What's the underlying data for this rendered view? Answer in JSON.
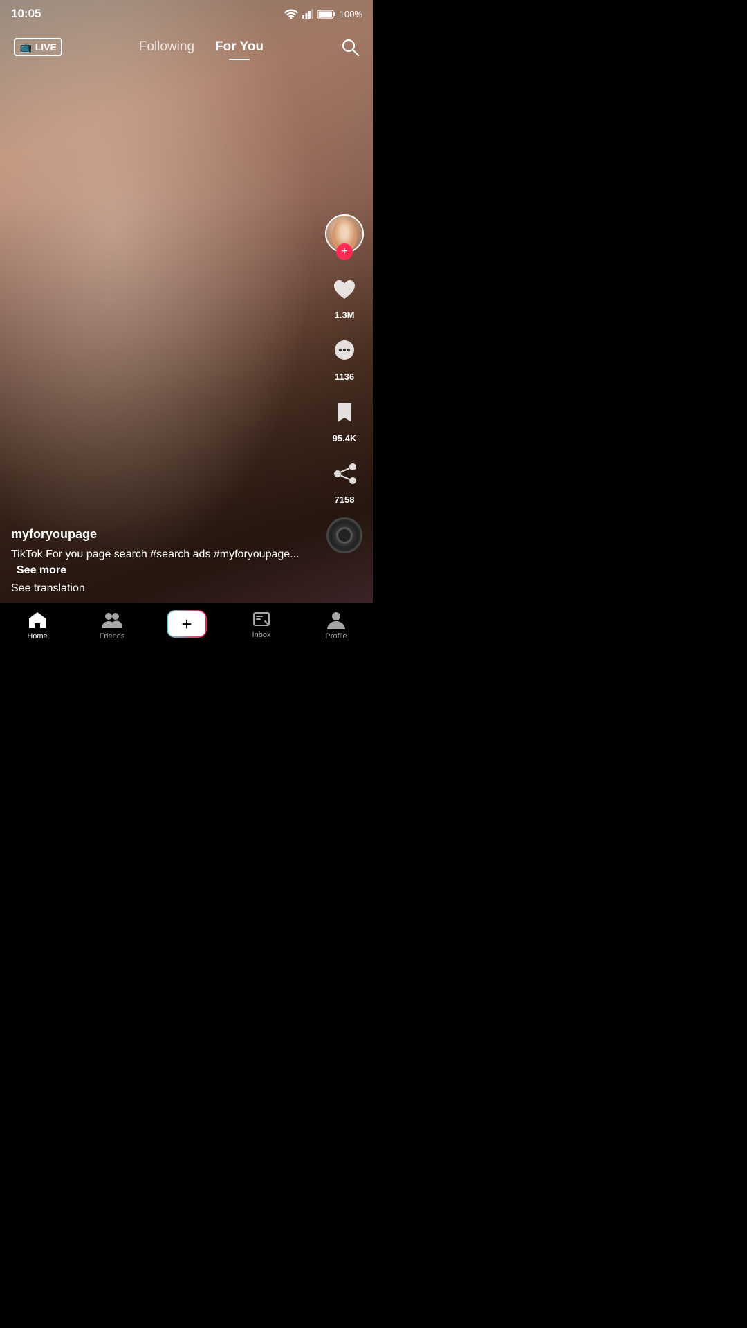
{
  "status": {
    "time": "10:05",
    "battery": "100%",
    "wifi": true,
    "signal": true
  },
  "nav": {
    "live_label": "LIVE",
    "following_label": "Following",
    "foryou_label": "For You",
    "active_tab": "foryou"
  },
  "video": {
    "username": "myforyoupage",
    "caption": "TikTok For you page search #search ads #myforyoupage...",
    "see_more": "See more",
    "see_translation": "See translation"
  },
  "actions": {
    "like_count": "1.3M",
    "comment_count": "1136",
    "bookmark_count": "95.4K",
    "share_count": "7158"
  },
  "bottom_nav": {
    "home": "Home",
    "friends": "Friends",
    "plus": "+",
    "inbox": "Inbox",
    "profile": "Profile"
  }
}
